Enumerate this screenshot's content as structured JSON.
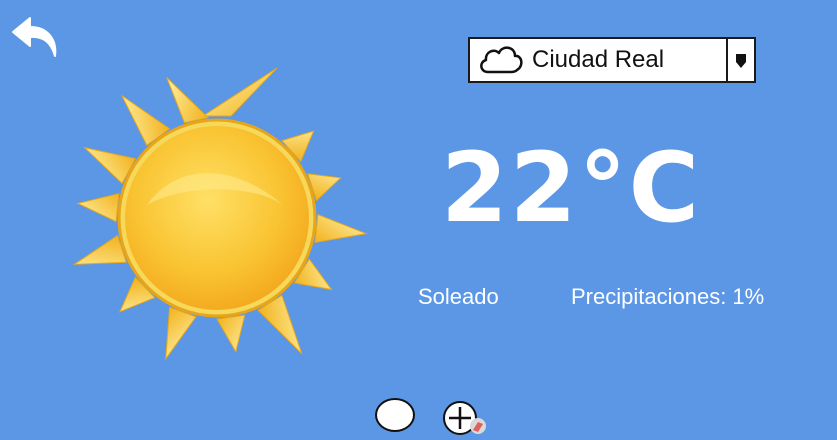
{
  "location": {
    "selected": "Ciudad Real",
    "icon": "cloud-icon"
  },
  "weather": {
    "temperature": "22°C",
    "condition": "Soleado",
    "precipitation": "Precipitaciones: 1%",
    "icon": "sun-icon"
  },
  "navigation": {
    "back_icon": "back-arrow-icon",
    "pages_icon": "page-indicator-dot",
    "add_icon": "add-location-icon"
  },
  "colors": {
    "background": "#5b97e5",
    "text": "#ffffff",
    "sun": "#f7c531"
  }
}
